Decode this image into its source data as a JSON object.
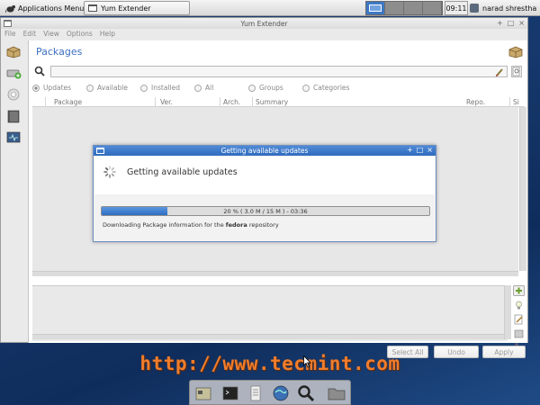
{
  "top_panel": {
    "apps_menu_label": "Applications Menu",
    "task_label": "Yum Extender",
    "clock": "09:11",
    "user": "narad shrestha"
  },
  "window": {
    "title": "Yum Extender",
    "controls": [
      "+",
      "□",
      "×"
    ],
    "menu": [
      "File",
      "Edit",
      "View",
      "Options",
      "Help"
    ]
  },
  "packages": {
    "title": "Packages",
    "search_placeholder": "",
    "filters": [
      {
        "label": "Updates",
        "checked": true
      },
      {
        "label": "Available",
        "checked": false
      },
      {
        "label": "Installed",
        "checked": false
      },
      {
        "label": "All",
        "checked": false
      },
      {
        "label": "Groups",
        "checked": false
      },
      {
        "label": "Categories",
        "checked": false
      }
    ],
    "columns": [
      "Package",
      "Ver.",
      "Arch.",
      "Summary",
      "Repo.",
      "Si"
    ]
  },
  "buttons": {
    "select_all": "Select All",
    "undo": "Undo",
    "apply": "Apply"
  },
  "dialog": {
    "title": "Getting available updates",
    "controls": [
      "+",
      "□",
      "×"
    ],
    "message": "Getting available updates",
    "progress_text": "20 % ( 3.0 M / 15 M ) - 03:36",
    "progress_fraction": 0.2,
    "download_prefix": "Downloading Package information for the",
    "download_repo": "fedora",
    "download_suffix": "repository"
  },
  "watermark": "http://www.tecmint.com",
  "colors": {
    "accent": "#3c6fc0",
    "dialog_title": "#2f6bbf",
    "watermark": "#f07d2c",
    "desktop": "#16386c"
  },
  "dock_icons": [
    "file-manager-icon",
    "terminal-icon",
    "text-editor-icon",
    "web-browser-icon",
    "search-icon",
    "folder-icon"
  ]
}
